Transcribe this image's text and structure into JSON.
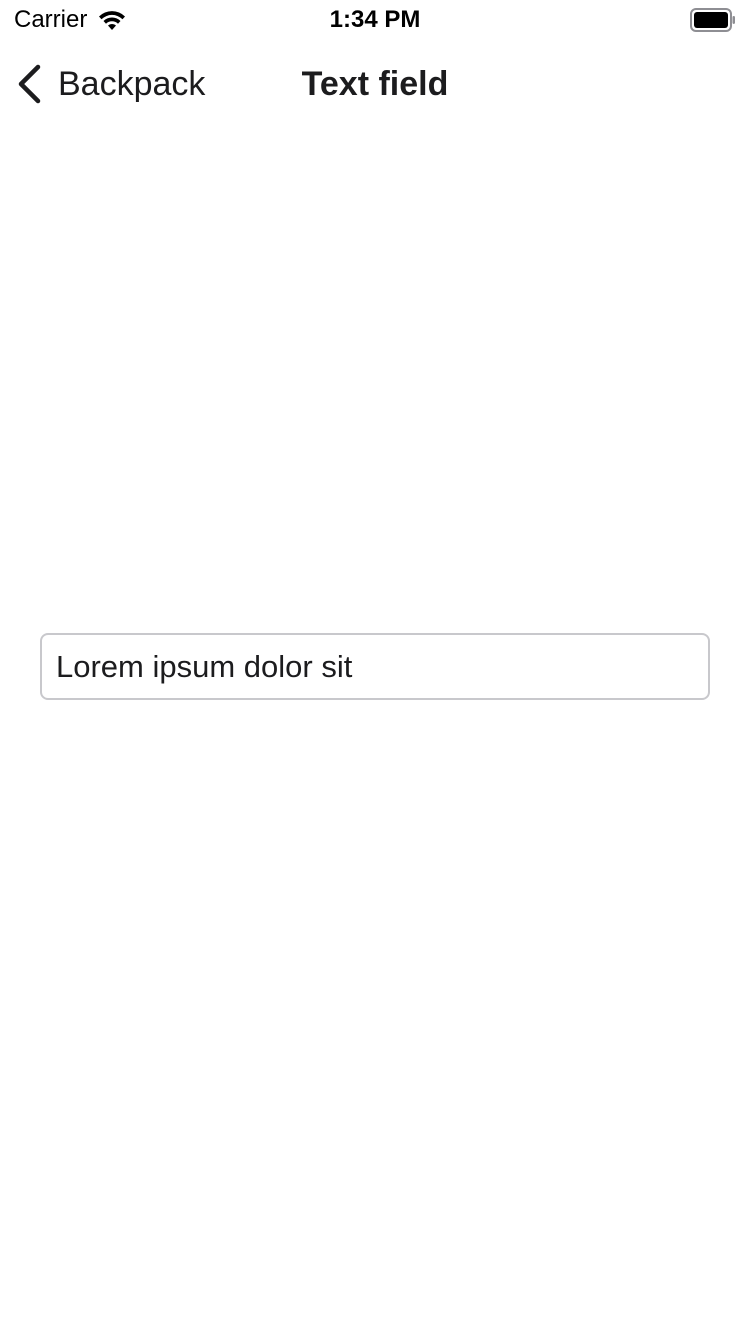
{
  "status_bar": {
    "carrier": "Carrier",
    "time": "1:34 PM",
    "wifi_icon": "wifi-icon",
    "battery_icon": "battery-icon"
  },
  "nav": {
    "back_label": "Backpack",
    "back_icon": "chevron-left-icon",
    "title": "Text field"
  },
  "text_field": {
    "value": "Lorem ipsum dolor sit"
  },
  "colors": {
    "background": "#ffffff",
    "text": "#1c1c1e",
    "field_border": "#c8c8cc"
  }
}
